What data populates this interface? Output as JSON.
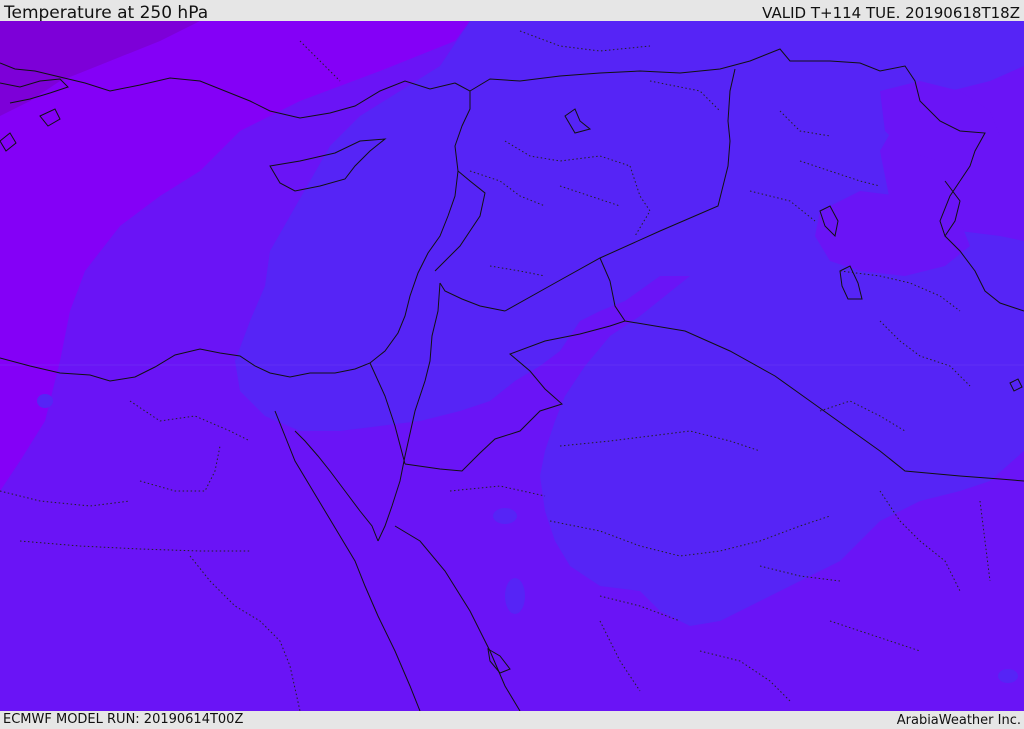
{
  "header": {
    "title": "Temperature at 250 hPa",
    "valid_time": "VALID T+114 TUE. 20190618T18Z"
  },
  "footer": {
    "model_run": "ECMWF MODEL RUN: 20190614T00Z",
    "credit": "ArabiaWeather Inc."
  },
  "map": {
    "field": "Temperature at 250 hPa",
    "colors": {
      "background_band": "#6a14f6",
      "cold_west_band": "#8400f7",
      "coldest_corner_band": "#7d00d8",
      "warm_band": "#5624f6",
      "coastline": "#111111",
      "country_border": "#111111",
      "admin_border": "#222222"
    }
  }
}
